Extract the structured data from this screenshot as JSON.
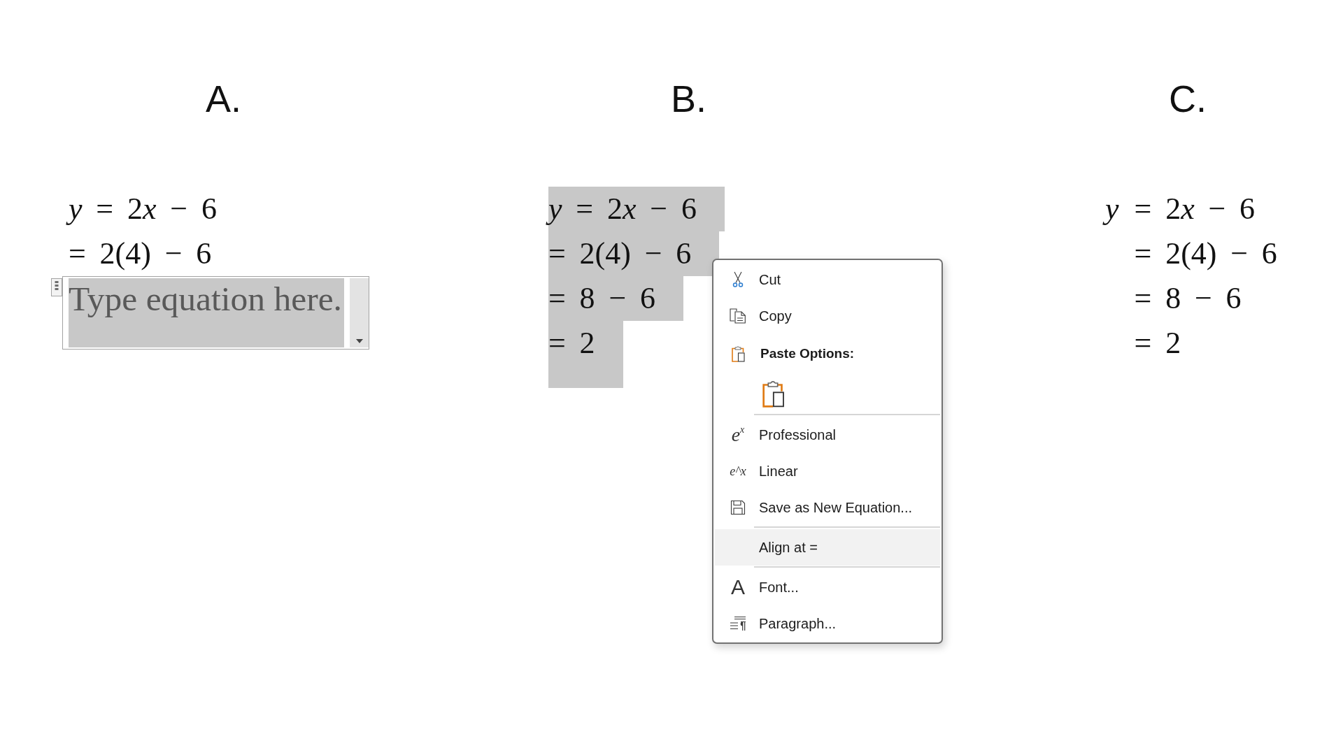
{
  "columns": [
    {
      "heading": "A.",
      "lines": [
        {
          "text": "y = 2x − 6",
          "selected": false
        },
        {
          "text": "= 2(4) − 6",
          "selected": false
        }
      ],
      "equation_field": {
        "placeholder": "Type equation here."
      }
    },
    {
      "heading": "B.",
      "lines": [
        {
          "text": "y = 2x − 6",
          "selected": true
        },
        {
          "text": "= 2(4) − 6",
          "selected": true
        },
        {
          "text": "= 8 − 6",
          "selected": true
        },
        {
          "text": "= 2",
          "selected": true
        }
      ]
    },
    {
      "heading": "C.",
      "lines": [
        {
          "lhs": "y",
          "text": "= 2x − 6",
          "selected": false
        },
        {
          "text": "= 2(4) − 6",
          "selected": false
        },
        {
          "text": "= 8 − 6",
          "selected": false
        },
        {
          "text": "= 2",
          "selected": false
        }
      ]
    }
  ],
  "context_menu": {
    "items": [
      {
        "kind": "command",
        "label": "Cut",
        "highlighted": false
      },
      {
        "kind": "command",
        "label": "Copy",
        "highlighted": false
      },
      {
        "kind": "heading",
        "label": "Paste Options:"
      },
      {
        "kind": "paste-option"
      },
      {
        "kind": "separator"
      },
      {
        "kind": "command",
        "glyph": "e$^{x}$",
        "label": "Professional",
        "highlighted": false
      },
      {
        "kind": "command",
        "glyph": "e^x",
        "label": "Linear",
        "highlighted": false
      },
      {
        "kind": "command",
        "label": "Save as New Equation...",
        "highlighted": false
      },
      {
        "kind": "separator"
      },
      {
        "kind": "command",
        "label": "Align at =",
        "highlighted": true
      },
      {
        "kind": "separator"
      },
      {
        "kind": "command",
        "glyph": "A",
        "label": "Font...",
        "highlighted": false
      },
      {
        "kind": "command",
        "label": "Paragraph...",
        "highlighted": false
      }
    ]
  }
}
